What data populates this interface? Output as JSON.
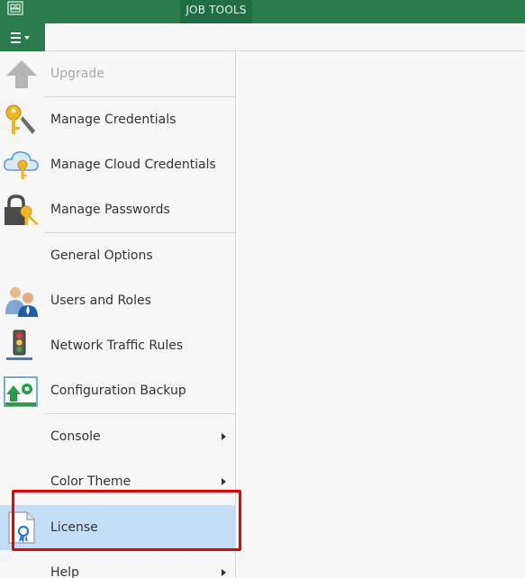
{
  "titlebar": {
    "context_tab": "JOB TOOLS"
  },
  "menu_button": {
    "icon": "hamburger-menu-icon"
  },
  "menu": {
    "items": [
      {
        "label": "Upgrade",
        "icon": "up-arrow-icon",
        "disabled": true
      },
      {
        "label": "Manage Credentials",
        "icon": "key-icon"
      },
      {
        "label": "Manage Cloud Credentials",
        "icon": "cloud-key-icon"
      },
      {
        "label": "Manage Passwords",
        "icon": "lock-key-icon"
      },
      {
        "label": "General Options",
        "icon": ""
      },
      {
        "label": "Users and Roles",
        "icon": "users-icon"
      },
      {
        "label": "Network Traffic Rules",
        "icon": "traffic-light-icon"
      },
      {
        "label": "Configuration Backup",
        "icon": "config-backup-icon"
      },
      {
        "label": "Console",
        "has_submenu": true
      },
      {
        "label": "Color Theme",
        "has_submenu": true
      },
      {
        "label": "License",
        "icon": "license-icon",
        "selected": true
      },
      {
        "label": "Help",
        "has_submenu": true
      }
    ]
  },
  "colors": {
    "accent": "#2a7c4f",
    "selected": "#c4def7",
    "annotation": "#f00000"
  }
}
